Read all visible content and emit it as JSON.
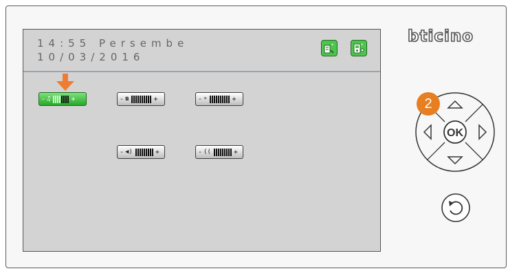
{
  "brand": {
    "logo_text": "bticino"
  },
  "screen": {
    "time": "14:55 Persembe",
    "date": "10/03/2016",
    "top_icons": [
      "handset-speaker-icon",
      "intercom-unit-icon"
    ],
    "controls": [
      {
        "id": "ringtone-volume",
        "icon": "music-note-icon",
        "minus": "-",
        "plus": "+",
        "selected": true,
        "level": 0.5
      },
      {
        "id": "handset-volume",
        "icon": "handset-icon",
        "minus": "-",
        "plus": "+",
        "selected": false,
        "level": 1.0
      },
      {
        "id": "microphone-sensitivity",
        "icon": "microphone-waves-icon",
        "minus": "-",
        "plus": "+",
        "selected": false,
        "level": 1.0
      },
      {
        "id": "speaker-volume",
        "icon": "speaker-icon",
        "minus": "-",
        "plus": "+",
        "selected": false,
        "level": 1.0
      },
      {
        "id": "loop-volume",
        "icon": "induction-loop-icon",
        "minus": "-",
        "plus": "+",
        "selected": false,
        "level": 1.0
      }
    ],
    "pointer_icon": "orange-down-arrow-icon"
  },
  "keypad": {
    "step_badge": "2",
    "ok_label": "OK",
    "directions": [
      "up-arrow-icon",
      "down-arrow-icon",
      "left-arrow-icon",
      "right-arrow-icon"
    ],
    "back_icon": "back-return-icon"
  },
  "colors": {
    "accent_green": "#3cba3c",
    "badge_orange": "#e67e22",
    "screen_bg": "#d3d3d3"
  }
}
